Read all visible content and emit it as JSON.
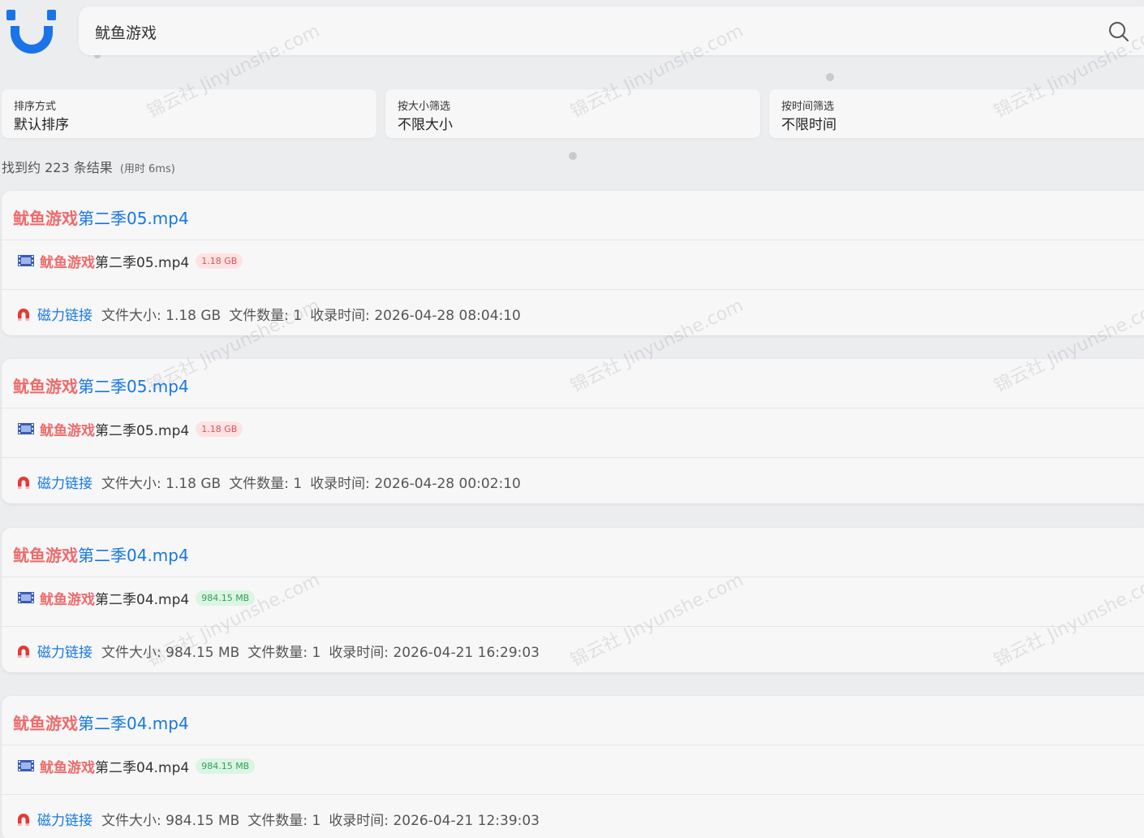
{
  "search": {
    "query": "鱿鱼游戏"
  },
  "filters": [
    {
      "label": "排序方式",
      "value": "默认排序"
    },
    {
      "label": "按大小筛选",
      "value": "不限大小"
    },
    {
      "label": "按时间筛选",
      "value": "不限时间"
    }
  ],
  "summary": {
    "prefix": "找到约 ",
    "count": "223",
    "suffix": " 条结果",
    "timing": "(用时 6ms)"
  },
  "results": [
    {
      "title_highlight": "鱿鱼游戏",
      "title_rest": "第二季05.mp4",
      "file_highlight": "鱿鱼游戏",
      "file_rest": "第二季05.mp4",
      "size_badge": "1.18 GB",
      "badge_color": "red",
      "magnet_label": "磁力链接",
      "file_size": "文件大小: 1.18 GB",
      "file_count": "文件数量: 1",
      "indexed_time": "收录时间: 2026-04-28 08:04:10"
    },
    {
      "title_highlight": "鱿鱼游戏",
      "title_rest": "第二季05.mp4",
      "file_highlight": "鱿鱼游戏",
      "file_rest": "第二季05.mp4",
      "size_badge": "1.18 GB",
      "badge_color": "red",
      "magnet_label": "磁力链接",
      "file_size": "文件大小: 1.18 GB",
      "file_count": "文件数量: 1",
      "indexed_time": "收录时间: 2026-04-28 00:02:10"
    },
    {
      "title_highlight": "鱿鱼游戏",
      "title_rest": "第二季04.mp4",
      "file_highlight": "鱿鱼游戏",
      "file_rest": "第二季04.mp4",
      "size_badge": "984.15 MB",
      "badge_color": "green",
      "magnet_label": "磁力链接",
      "file_size": "文件大小: 984.15 MB",
      "file_count": "文件数量: 1",
      "indexed_time": "收录时间: 2026-04-21 16:29:03"
    },
    {
      "title_highlight": "鱿鱼游戏",
      "title_rest": "第二季04.mp4",
      "file_highlight": "鱿鱼游戏",
      "file_rest": "第二季04.mp4",
      "size_badge": "984.15 MB",
      "badge_color": "green",
      "magnet_label": "磁力链接",
      "file_size": "文件大小: 984.15 MB",
      "file_count": "文件数量: 1",
      "indexed_time": "收录时间: 2026-04-21 12:39:03"
    }
  ],
  "watermark": "锦云社 Jinyunshe.com",
  "colors": {
    "accent": "#1677e5",
    "highlight": "#ef6b6b",
    "logo": "#1a73e8"
  },
  "icons": [
    "logo-icon",
    "search-icon",
    "film-icon",
    "magnet-icon"
  ]
}
